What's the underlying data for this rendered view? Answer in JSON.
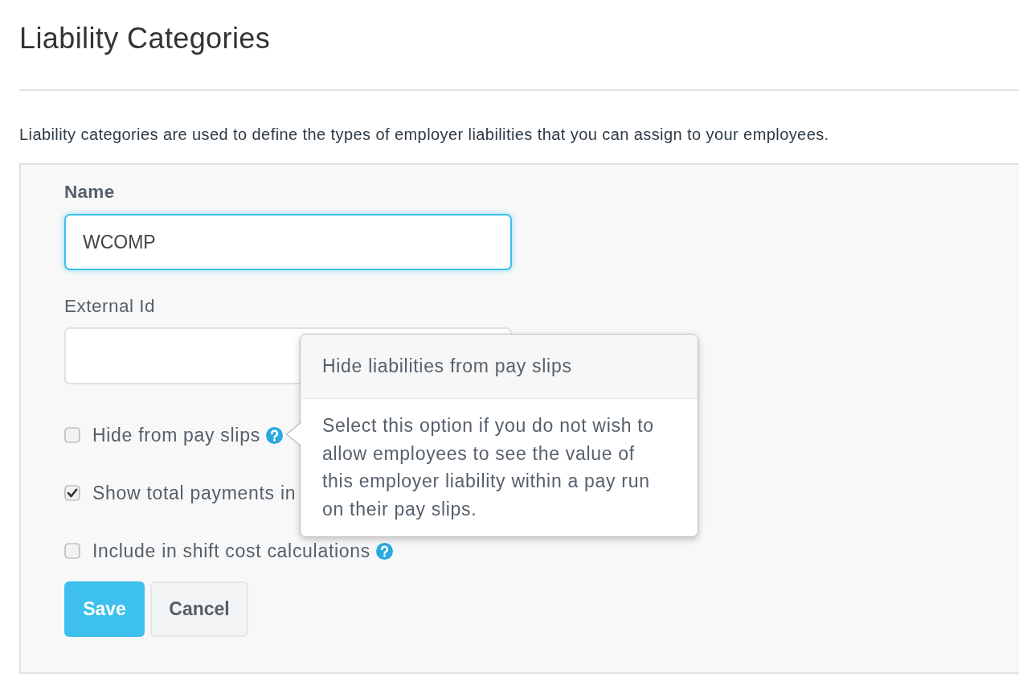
{
  "page": {
    "title": "Liability Categories",
    "description": "Liability categories are used to define the types of employer liabilities that you can assign to your employees."
  },
  "form": {
    "fields": [
      {
        "label": "Name",
        "label_bold": true,
        "value": "WCOMP",
        "focused": true
      },
      {
        "label": "External Id",
        "label_bold": false,
        "focused": false
      }
    ],
    "checkboxes": [
      {
        "label": "Hide from pay slips",
        "checked": false,
        "help_icon": true
      },
      {
        "label": "Show total payments in",
        "checked": true,
        "help_icon": false
      },
      {
        "label": "Include in shift cost calculations",
        "checked": false,
        "help_icon": true
      }
    ],
    "buttons": [
      {
        "label": "Save",
        "kind": "primary"
      },
      {
        "label": "Cancel",
        "kind": "secondary"
      }
    ],
    "popover": {
      "title": "Hide liabilities from pay slips",
      "text": "Select this option if you do not wish to allow employees to see the value of this employer liability within a pay run on their pay slips."
    }
  }
}
